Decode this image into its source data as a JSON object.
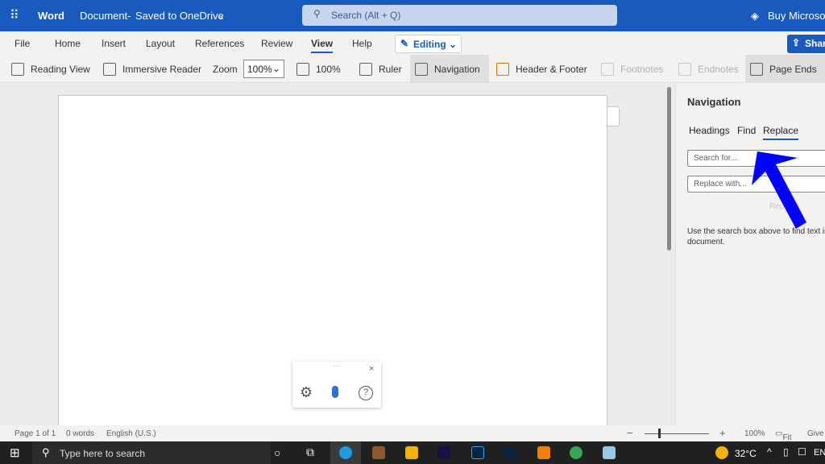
{
  "titlebar": {
    "app": "Word",
    "doc": "Document",
    "sep": "-",
    "saved": "Saved to OneDrive",
    "search_placeholder": "Search (Alt + Q)",
    "buy": "Buy Microsoft"
  },
  "tabs": [
    "File",
    "Home",
    "Insert",
    "Layout",
    "References",
    "Review",
    "View",
    "Help"
  ],
  "active_tab": "View",
  "editing": "Editing",
  "share": "Share",
  "toolbar": {
    "reading_view": "Reading View",
    "immersive_reader": "Immersive Reader",
    "zoom_label": "Zoom",
    "zoom_value": "100%",
    "zoom100": "100%",
    "ruler": "Ruler",
    "navigation": "Navigation",
    "header_footer": "Header & Footer",
    "footnotes": "Footnotes",
    "endnotes": "Endnotes",
    "page_ends": "Page Ends"
  },
  "nav": {
    "title": "Navigation",
    "tabs": [
      "Headings",
      "Find",
      "Replace"
    ],
    "active": "Replace",
    "search_placeholder": "Search for...",
    "replace_placeholder": "Replace with...",
    "replace_btn": "Replace",
    "hint": "Use the search box above to find text in the document."
  },
  "dictation": {
    "close": "×"
  },
  "status": {
    "page": "Page 1 of 1",
    "words": "0 words",
    "lang": "English (U.S.)",
    "zoom": "100%",
    "fit": "Fit",
    "feedback": "Give"
  },
  "taskbar": {
    "search": "Type here to search",
    "temp": "32°C",
    "lang": "EN"
  },
  "colors": {
    "brand": "#185abd",
    "arrow": "#0000ff"
  }
}
